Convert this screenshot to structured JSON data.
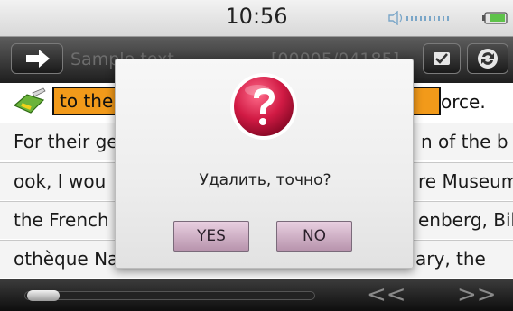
{
  "status_bar": {
    "time": "10:56",
    "icons": [
      "volume-icon",
      "battery-icon"
    ]
  },
  "toolbar": {
    "document_title": "Sample text",
    "position": "[00005/04185]",
    "icons": [
      "arrow-right-icon",
      "checkmark-icon",
      "sync-icon"
    ]
  },
  "reader": {
    "highlight_left": "to the",
    "highlight_right": "orce.",
    "lines": [
      {
        "left": "For their ge",
        "right": "n of the b"
      },
      {
        "left": "ook, I wou",
        "right": "re Museum,"
      },
      {
        "left": "the French",
        "right": "enberg, Bibli"
      },
      {
        "left": "othèque Na",
        "right": "ary, the"
      }
    ]
  },
  "dialog": {
    "icon": "question-mark-icon",
    "message": "Удалить, точно?",
    "yes_label": "YES",
    "no_label": "NO"
  },
  "bottom_bar": {
    "prev_label": "<<",
    "next_label": ">>",
    "progress": 0.03
  },
  "colors": {
    "highlight": "#f29a1a",
    "dialog_button": "#c9a6bf",
    "question_icon": "#c8143c"
  }
}
